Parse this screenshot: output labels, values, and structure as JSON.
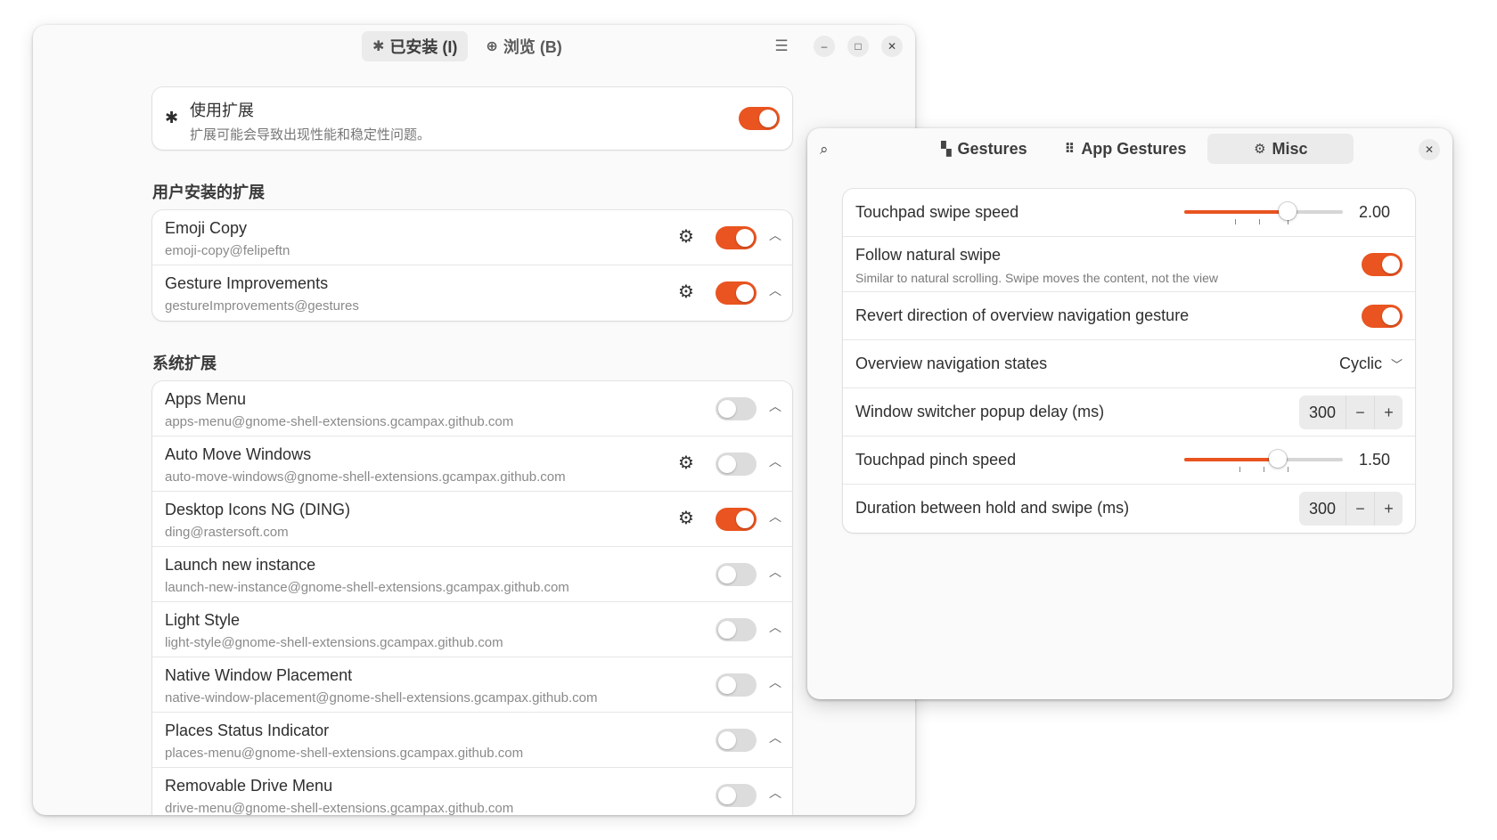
{
  "extensions_window": {
    "tabs": [
      {
        "label": "已安装 (I)",
        "icon": "puzzle-icon",
        "active": true
      },
      {
        "label": "浏览 (B)",
        "icon": "globe-icon",
        "active": false
      }
    ],
    "main": {
      "title": "使用扩展",
      "subtitle": "扩展可能会导致出现性能和稳定性问题。",
      "enabled": true
    },
    "user_section_title": "用户安装的扩展",
    "user_extensions": [
      {
        "name": "Emoji Copy",
        "uuid": "emoji-copy@felipeftn",
        "settings": true,
        "enabled": true
      },
      {
        "name": "Gesture Improvements",
        "uuid": "gestureImprovements@gestures",
        "settings": true,
        "enabled": true
      }
    ],
    "system_section_title": "系统扩展",
    "system_extensions": [
      {
        "name": "Apps Menu",
        "uuid": "apps-menu@gnome-shell-extensions.gcampax.github.com",
        "settings": false,
        "enabled": false
      },
      {
        "name": "Auto Move Windows",
        "uuid": "auto-move-windows@gnome-shell-extensions.gcampax.github.com",
        "settings": true,
        "enabled": false
      },
      {
        "name": "Desktop Icons NG (DING)",
        "uuid": "ding@rastersoft.com",
        "settings": true,
        "enabled": true
      },
      {
        "name": "Launch new instance",
        "uuid": "launch-new-instance@gnome-shell-extensions.gcampax.github.com",
        "settings": false,
        "enabled": false
      },
      {
        "name": "Light Style",
        "uuid": "light-style@gnome-shell-extensions.gcampax.github.com",
        "settings": false,
        "enabled": false
      },
      {
        "name": "Native Window Placement",
        "uuid": "native-window-placement@gnome-shell-extensions.gcampax.github.com",
        "settings": false,
        "enabled": false
      },
      {
        "name": "Places Status Indicator",
        "uuid": "places-menu@gnome-shell-extensions.gcampax.github.com",
        "settings": false,
        "enabled": false
      },
      {
        "name": "Removable Drive Menu",
        "uuid": "drive-menu@gnome-shell-extensions.gcampax.github.com",
        "settings": false,
        "enabled": false
      }
    ]
  },
  "prefs_window": {
    "tabs": [
      {
        "label": "Gestures",
        "icon": "clapperboard-icon",
        "active": false
      },
      {
        "label": "App Gestures",
        "icon": "app-grid-icon",
        "active": false
      },
      {
        "label": "Misc",
        "icon": "gear-icon",
        "active": true
      }
    ],
    "rows": {
      "swipe_speed": {
        "label": "Touchpad swipe speed",
        "value": "2.00",
        "fraction": 0.65
      },
      "natural_swipe": {
        "label": "Follow natural swipe",
        "subtitle": "Similar to natural scrolling. Swipe moves the content, not the view",
        "enabled": true
      },
      "revert_direction": {
        "label": "Revert direction of overview navigation gesture",
        "enabled": true
      },
      "nav_states": {
        "label": "Overview navigation states",
        "value": "Cyclic"
      },
      "popup_delay": {
        "label": "Window switcher popup delay (ms)",
        "value": "300"
      },
      "pinch_speed": {
        "label": "Touchpad pinch speed",
        "value": "1.50",
        "fraction": 0.59
      },
      "hold_swipe": {
        "label": "Duration between hold and swipe (ms)",
        "value": "300"
      }
    }
  },
  "colors": {
    "accent": "#e95420"
  }
}
